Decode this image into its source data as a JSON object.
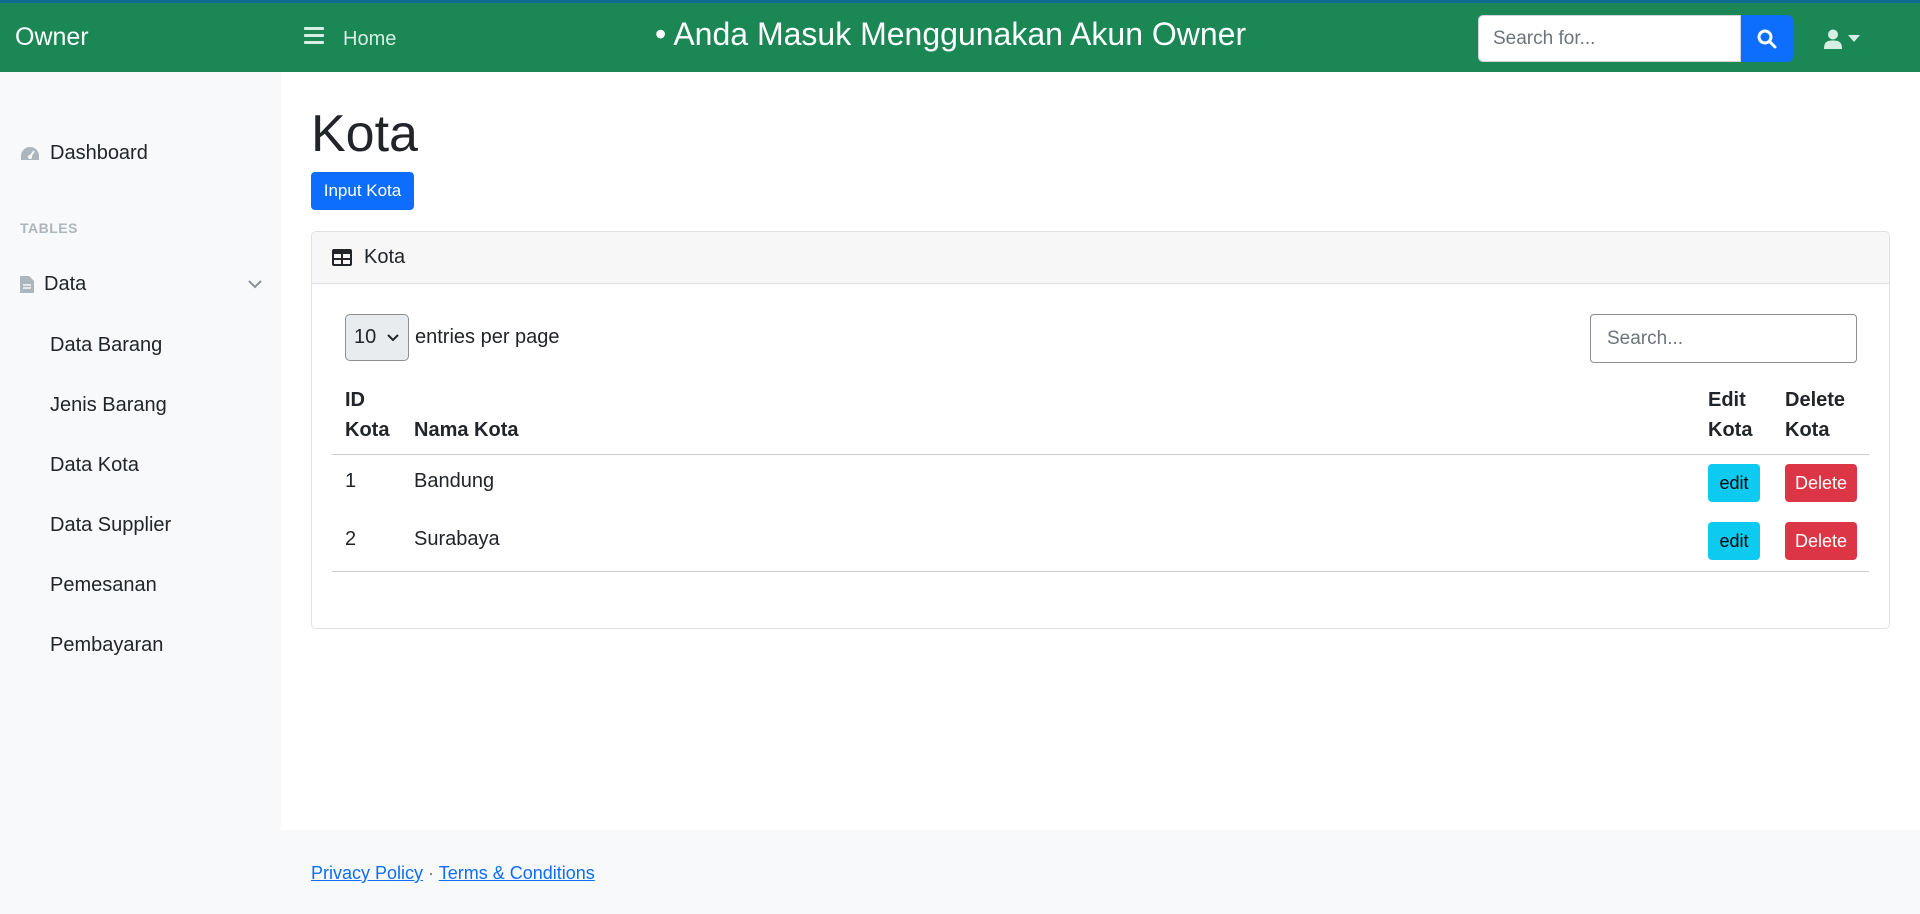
{
  "navbar": {
    "brand": "Owner",
    "home": "Home",
    "welcome": "• Anda Masuk Menggunakan Akun Owner",
    "search_placeholder": "Search for..."
  },
  "sidebar": {
    "dashboard": "Dashboard",
    "heading": "TABLES",
    "data_group": "Data",
    "items": [
      {
        "label": "Data Barang"
      },
      {
        "label": "Jenis Barang"
      },
      {
        "label": "Data Kota"
      },
      {
        "label": "Data Supplier"
      },
      {
        "label": "Pemesanan"
      },
      {
        "label": "Pembayaran"
      }
    ]
  },
  "main": {
    "title": "Kota",
    "input_button": "Input Kota",
    "card_title": "Kota",
    "per_page_value": "10",
    "per_page_label": "entries per page",
    "search_placeholder": "Search...",
    "columns": {
      "id_line1": "ID",
      "id_line2": "Kota",
      "name": "Nama Kota",
      "edit_line1": "Edit",
      "edit_line2": "Kota",
      "delete_line1": "Delete",
      "delete_line2": "Kota"
    },
    "rows": [
      {
        "id": "1",
        "name": "Bandung",
        "edit": "edit",
        "delete": "Delete"
      },
      {
        "id": "2",
        "name": "Surabaya",
        "edit": "edit",
        "delete": "Delete"
      }
    ]
  },
  "footer": {
    "privacy": "Privacy Policy",
    "separator": "·",
    "terms": "Terms & Conditions"
  },
  "colors": {
    "navbar": "#1b8755",
    "primary": "#0d6efd",
    "info": "#0dcaf0",
    "danger": "#dc3545"
  }
}
